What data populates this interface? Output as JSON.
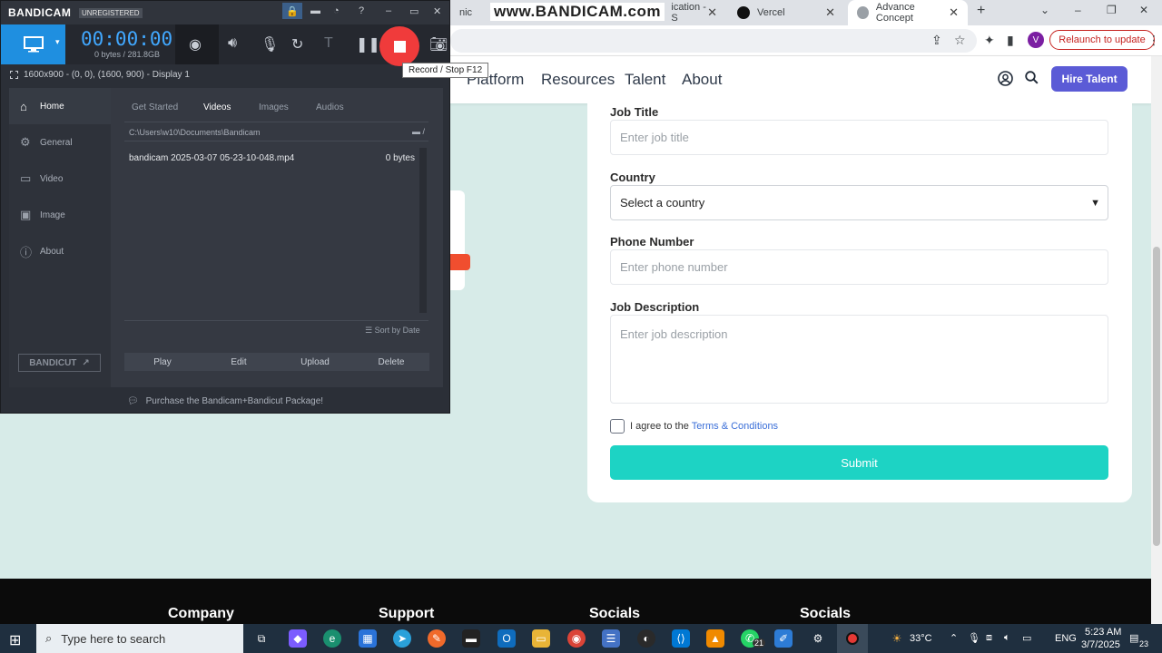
{
  "browser": {
    "tabs": [
      {
        "label": "nic"
      },
      {
        "label": "ication - S"
      },
      {
        "label": "Vercel"
      },
      {
        "label": "Advance Concept"
      }
    ],
    "relaunch_label": "Relaunch to update",
    "profile_initial": "V"
  },
  "site": {
    "nav_links": [
      "Platform",
      "Resources",
      "Talent",
      "About"
    ],
    "hire_label": "Hire Talent",
    "form": {
      "job_title_label": "Job Title",
      "job_title_placeholder": "Enter job title",
      "country_label": "Country",
      "country_value": "Select a country",
      "phone_label": "Phone Number",
      "phone_placeholder": "Enter phone number",
      "description_label": "Job Description",
      "description_placeholder": "Enter job description",
      "terms_prefix": "I agree to the ",
      "terms_link": "Terms & Conditions",
      "submit_label": "Submit"
    },
    "footer_headings": [
      "Company",
      "Support",
      "Socials",
      "Socials"
    ]
  },
  "watermark": "www.BANDICAM.com",
  "bandicam": {
    "logo": "BANDICAM",
    "unregistered": "UNREGISTERED",
    "timer": "00:00:00",
    "size": "0 bytes / 281.8GB",
    "tooltip": "Record / Stop   F12",
    "region": "1600x900 - (0, 0), (1600, 900) - Display 1",
    "sidebar": [
      "Home",
      "General",
      "Video",
      "Image",
      "About"
    ],
    "bandicut_label": "BANDICUT",
    "tabs": [
      "Get Started",
      "Videos",
      "Images",
      "Audios"
    ],
    "path": "C:\\Users\\w10\\Documents\\Bandicam",
    "files": [
      {
        "name": "bandicam 2025-03-07 05-23-10-048.mp4",
        "size": "0 bytes"
      }
    ],
    "sort_label": "Sort by Date",
    "actions": [
      "Play",
      "Edit",
      "Upload",
      "Delete"
    ],
    "status": "Purchase the Bandicam+Bandicut Package!"
  },
  "taskbar": {
    "search_placeholder": "Type here to search",
    "whatsapp_badge": "21",
    "weather": "33°C",
    "language": "ENG",
    "time": "5:23 AM",
    "date": "3/7/2025",
    "notifications": "23"
  },
  "colors": {
    "accent_teal": "#1dd3c4",
    "hire_purple": "#5b5bd6",
    "bandicam_blue": "#1f8fe0",
    "record_red": "#f03b3b"
  }
}
